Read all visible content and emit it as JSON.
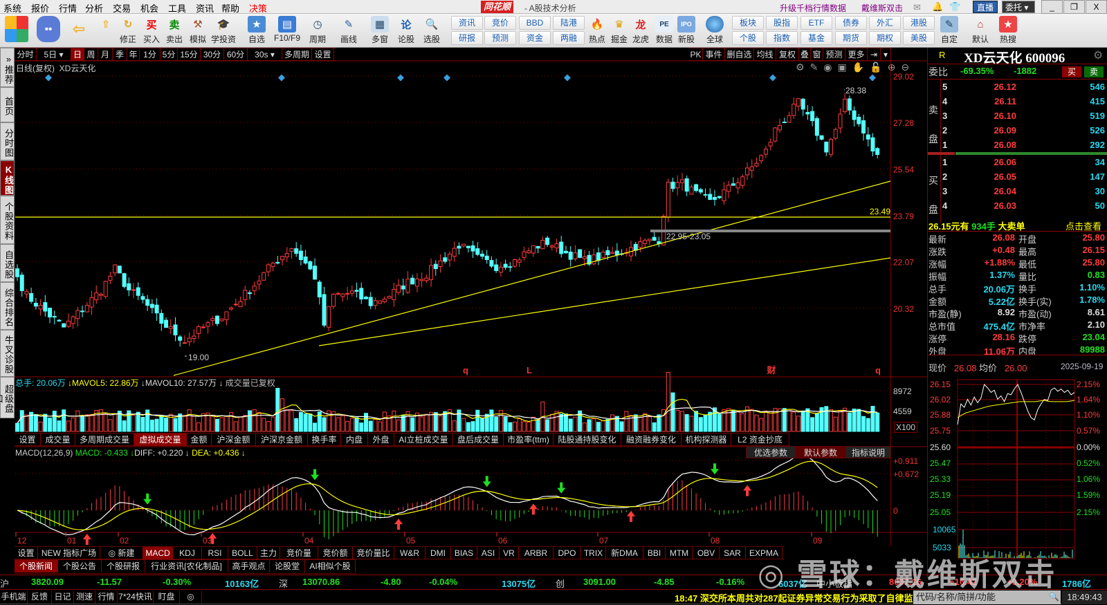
{
  "menu": [
    "系统",
    "报价",
    "行情",
    "分析",
    "交易",
    "机会",
    "工具",
    "资讯",
    "帮助",
    "决策"
  ],
  "title": {
    "logo": "同花顺",
    "app": "- A股技术分析",
    "promo1": "升级千档行情数据",
    "promo2": "戴维斯双击",
    "live": "直播",
    "entrust": "委托",
    "win_min": "_",
    "win_max": "❐",
    "win_close": "X"
  },
  "toolbar": {
    "icons": [
      {
        "label": "",
        "icon": "app-grid"
      },
      {
        "label": "",
        "icon": "robot"
      },
      {
        "label": "",
        "icon": "back-arrow"
      },
      {
        "label": "",
        "icon": "up-down-arrows"
      },
      {
        "label": "修正",
        "icon": "refresh"
      },
      {
        "label": "买入",
        "icon": "buy"
      },
      {
        "label": "卖出",
        "icon": "sell"
      },
      {
        "label": "模拟",
        "icon": "gavel"
      },
      {
        "label": "学投资",
        "icon": "graduation-cap"
      },
      {
        "label": "自选",
        "icon": "star-folder"
      },
      {
        "label": "F10/F9",
        "icon": "document"
      },
      {
        "label": "周期",
        "icon": "clock"
      },
      {
        "label": "画线",
        "icon": "pencil"
      },
      {
        "label": "多窗",
        "icon": "windows"
      },
      {
        "label": "论股",
        "icon": "forum"
      },
      {
        "label": "选股",
        "icon": "stock-search"
      }
    ],
    "pairs1": [
      [
        "资讯",
        "研报"
      ],
      [
        "竞价",
        "预测"
      ],
      [
        "BBD",
        "资金"
      ],
      [
        "陆港",
        "两融"
      ]
    ],
    "icons2": [
      {
        "label": "热点",
        "icon": "hot-fire"
      },
      {
        "label": "掘金",
        "icon": "gold"
      },
      {
        "label": "龙虎",
        "icon": "dragon"
      },
      {
        "label": "数据",
        "icon": "pe-data"
      },
      {
        "label": "新股",
        "icon": "ipo"
      },
      {
        "label": "全球",
        "icon": "globe"
      }
    ],
    "pairs2": [
      [
        "板块",
        "个股"
      ],
      [
        "股指",
        "指数"
      ],
      [
        "ETF",
        "基金"
      ],
      [
        "债券",
        "期货"
      ],
      [
        "外汇",
        "期权"
      ],
      [
        "港股",
        "美股"
      ]
    ],
    "icons3": [
      {
        "label": "自定",
        "icon": "customize"
      },
      {
        "label": "默认",
        "icon": "home"
      },
      {
        "label": "热搜",
        "icon": "hot-search"
      }
    ]
  },
  "sidebar": [
    {
      "label": "»推荐"
    },
    {
      "label": "首页"
    },
    {
      "label": "分时图"
    },
    {
      "label": "K线图",
      "active": true
    },
    {
      "label": "个股资料"
    },
    {
      "label": "自选股"
    },
    {
      "label": "综合排名"
    },
    {
      "label": "牛叉诊股"
    },
    {
      "label": "超级盘口"
    }
  ],
  "period_tabs": [
    {
      "label": "分时"
    },
    {
      "label": "5日 ▾"
    },
    {
      "label": "日",
      "active": true
    },
    {
      "label": "周"
    },
    {
      "label": "月"
    },
    {
      "label": "季"
    },
    {
      "label": "年"
    },
    {
      "label": "1分"
    },
    {
      "label": "5分"
    },
    {
      "label": "15分"
    },
    {
      "label": "30分"
    },
    {
      "label": "60分"
    },
    {
      "label": "30s ▾"
    },
    {
      "label": "多周期"
    },
    {
      "label": "设置"
    }
  ],
  "right_tabs": [
    "PK",
    "事件",
    "删自选",
    "均线",
    "复权",
    "叠",
    "窗",
    "预测",
    "更多",
    "⇥",
    "▾"
  ],
  "kchart": {
    "label": "日线(复权)",
    "stock": "XD云天化",
    "y_ticks": [
      29.02,
      27.28,
      25.54,
      23.79,
      22.07,
      20.32
    ],
    "high_label": "28.38",
    "low_label": "19.00",
    "hline_label": "23.49",
    "zone_label": "22.95-23.05",
    "events": [
      "q",
      "L",
      "财",
      "q"
    ],
    "dates": [
      "12",
      "01",
      "02",
      "03",
      "04",
      "05",
      "06",
      "07",
      "08",
      "09"
    ]
  },
  "chart_data": {
    "type": "candlestick",
    "title": "XD云天化 日线(复权)",
    "ylim": [
      19.0,
      29.02
    ],
    "close_keypoints": [
      [
        0,
        21.5
      ],
      [
        2,
        20.8
      ],
      [
        6,
        20.2
      ],
      [
        10,
        19.6
      ],
      [
        14,
        20.3
      ],
      [
        18,
        21.0
      ],
      [
        21,
        21.8
      ],
      [
        24,
        21.0
      ],
      [
        27,
        20.6
      ],
      [
        31,
        19.8
      ],
      [
        36,
        19.1
      ],
      [
        40,
        19.6
      ],
      [
        44,
        20.0
      ],
      [
        47,
        20.5
      ],
      [
        51,
        21.2
      ],
      [
        55,
        22.0
      ],
      [
        59,
        22.6
      ],
      [
        62,
        22.0
      ],
      [
        64,
        21.5
      ],
      [
        66,
        19.7
      ],
      [
        68,
        20.8
      ],
      [
        72,
        20.9
      ],
      [
        76,
        20.5
      ],
      [
        80,
        20.8
      ],
      [
        84,
        21.3
      ],
      [
        88,
        21.6
      ],
      [
        92,
        22.2
      ],
      [
        95,
        22.7
      ],
      [
        99,
        22.2
      ],
      [
        103,
        21.9
      ],
      [
        107,
        22.1
      ],
      [
        111,
        22.6
      ],
      [
        114,
        22.8
      ],
      [
        118,
        22.4
      ],
      [
        122,
        22.1
      ],
      [
        127,
        22.3
      ],
      [
        131,
        22.5
      ],
      [
        135,
        22.8
      ],
      [
        138,
        22.9
      ],
      [
        140,
        24.9
      ],
      [
        143,
        25.0
      ],
      [
        146,
        24.6
      ],
      [
        149,
        24.3
      ],
      [
        153,
        24.8
      ],
      [
        158,
        25.6
      ],
      [
        161,
        26.2
      ],
      [
        163,
        27.0
      ],
      [
        166,
        27.6
      ],
      [
        168,
        28.0
      ],
      [
        171,
        27.2
      ],
      [
        174,
        26.3
      ],
      [
        176,
        27.0
      ],
      [
        178,
        28.0
      ],
      [
        180,
        27.5
      ],
      [
        182,
        27.0
      ],
      [
        184,
        26.2
      ],
      [
        185,
        26.08
      ]
    ],
    "bars": 186,
    "volume_spikes": [
      [
        56,
        9500
      ],
      [
        57,
        7200
      ],
      [
        113,
        6500
      ],
      [
        140,
        13000
      ],
      [
        141,
        8500
      ],
      [
        150,
        5200
      ],
      [
        170,
        5000
      ]
    ],
    "volume_ticks": [
      8972,
      4559
    ],
    "macd_ticks": [
      "+0.911",
      "+0.672",
      "0"
    ]
  },
  "volume": {
    "total": "总手: 20.06万",
    "mavol5": "↓MAVOL5: 22.86万",
    "mavol10": "↓MAVOL10: 27.57万 ↓",
    "note": "成交量已复权",
    "unit": "X100",
    "tabs": [
      "设置",
      "成交量",
      "多周期成交量",
      "虚拟成交量",
      "金额",
      "沪深金额",
      "沪深京金额",
      "换手率",
      "内盘",
      "外盘",
      "AI立桩成交量",
      "盘后成交量",
      "市盈率(ttm)",
      "陆股通持股变化",
      "融资融券变化",
      "机构探测器",
      "L2 资金抄底"
    ]
  },
  "macd": {
    "name": "MACD(12,26,9)",
    "macd": "MACD: -0.433 ↓",
    "diff": "DIFF: +0.220 ↓",
    "dea": "DEA: +0.436 ↓",
    "buttons": [
      "优选参数",
      "默认参数",
      "指标说明"
    ]
  },
  "indicator_tabs": [
    "设置",
    "NEW 指标广场",
    "◎ 新建",
    "MACD",
    "KDJ",
    "RSI",
    "BOLL",
    "主力",
    "竞价量",
    "竞价额",
    "竞价量比",
    "W&R",
    "DMI",
    "BIAS",
    "ASI",
    "VR",
    "ARBR",
    "DPO",
    "TRIX",
    "新DMA",
    "BBI",
    "MTM",
    "OBV",
    "SAR",
    "EXPMA"
  ],
  "news_tabs": [
    "个股新闻",
    "个股公告",
    "个股研报",
    "行业资讯[农化制品]",
    "高手观点",
    "论股堂",
    "AI相似个股"
  ],
  "quote": {
    "r": "R",
    "title": "XD云天化 600096",
    "weibi_label": "委比",
    "weibi": "-69.35%",
    "weicha": "-1882",
    "buy": "买",
    "sell": "卖",
    "sell_label": "卖盘",
    "buy_label": "买盘",
    "asks": [
      {
        "n": "5",
        "p": "26.12",
        "v": "546"
      },
      {
        "n": "4",
        "p": "26.11",
        "v": "415"
      },
      {
        "n": "3",
        "p": "26.10",
        "v": "519"
      },
      {
        "n": "2",
        "p": "26.09",
        "v": "526"
      },
      {
        "n": "1",
        "p": "26.08",
        "v": "292"
      }
    ],
    "bids": [
      {
        "n": "1",
        "p": "26.06",
        "v": "34"
      },
      {
        "n": "2",
        "p": "26.05",
        "v": "147"
      },
      {
        "n": "3",
        "p": "26.04",
        "v": "30"
      },
      {
        "n": "4",
        "p": "26.03",
        "v": "50"
      }
    ],
    "big_order": {
      "price": "26.15元有",
      "qty": "934手",
      "text": "大卖单",
      "link": "点击查看"
    },
    "rows": [
      [
        "最新",
        "26.08",
        "rp",
        "开盘",
        "25.80",
        "rp"
      ],
      [
        "涨跌",
        "+0.48",
        "rp",
        "最高",
        "26.15",
        "rp"
      ],
      [
        "涨幅",
        "+1.88%",
        "rp",
        "最低",
        "25.80",
        "rp"
      ],
      [
        "振幅",
        "1.37%",
        "cy",
        "量比",
        "0.83",
        "gp"
      ],
      [
        "总手",
        "20.06万",
        "cy",
        "换手",
        "1.10%",
        "cy"
      ],
      [
        "金额",
        "5.22亿",
        "cy",
        "换手(实)",
        "1.78%",
        "cy"
      ],
      [
        "市盈(静)",
        "8.92",
        "wh",
        "市盈(动)",
        "8.61",
        "wh"
      ],
      [
        "总市值",
        "475.4亿",
        "cy",
        "市净率",
        "2.10",
        "wh"
      ],
      [
        "涨停",
        "28.16",
        "rp",
        "跌停",
        "23.04",
        "gp"
      ],
      [
        "外盘",
        "11.06万",
        "rp",
        "内盘",
        "89988",
        "gp"
      ]
    ],
    "now_label": "现价",
    "now": "26.08",
    "avg_label": "均价",
    "avg": "26.00",
    "date": "2025-09-19"
  },
  "intraday": {
    "left_ticks": [
      "26.15",
      "26.02",
      "25.88",
      "25.75",
      "25.60",
      "25.47",
      "25.33",
      "25.19",
      "25.05"
    ],
    "right_ticks": [
      "2.15%",
      "1.64%",
      "1.10%",
      "0.57%",
      "0.00%",
      "0.52%",
      "1.06%",
      "1.59%",
      "2.15%"
    ],
    "vol_ticks": [
      "10065",
      "5033"
    ],
    "prices": [
      25.8,
      25.98,
      25.95,
      26.02,
      25.97,
      26.04,
      25.99,
      26.03,
      26.15,
      26.12,
      26.08,
      26.1,
      26.02,
      26.05,
      26.0,
      26.07,
      26.06,
      26.11,
      26.15,
      26.08,
      26.0,
      25.92,
      25.86,
      25.84,
      25.93,
      25.98,
      26.02,
      26.01,
      26.1,
      26.12,
      26.09,
      26.11,
      26.08,
      26.1,
      26.06,
      26.08
    ],
    "avg": [
      25.86,
      25.9,
      25.92,
      25.94,
      25.96,
      25.97,
      25.98,
      25.99,
      26.0,
      26.0,
      26.0,
      26.01,
      26.0,
      26.0,
      26.0,
      26.01
    ]
  },
  "indices": [
    {
      "name": "沪",
      "value": "3820.09",
      "chg": "-11.57",
      "pct": "-0.30%",
      "amt": "10163亿",
      "color": "gp"
    },
    {
      "name": "深",
      "value": "13070.86",
      "chg": "-4.80",
      "pct": "-0.04%",
      "amt": "13075亿",
      "color": "gp"
    },
    {
      "name": "创",
      "value": "3091.00",
      "chg": "-4.85",
      "pct": "-0.16%",
      "amt": "6037亿",
      "color": "gp"
    },
    {
      "name": "中小板指",
      "value": "8037.16",
      "chg": "+16.42",
      "pct": "+0.20%",
      "amt": "1786亿",
      "color": "rp"
    }
  ],
  "statusbar": {
    "items": [
      "手机端",
      "反馈",
      "日记",
      "测速",
      "行情",
      "7*24快讯",
      "盯盘",
      "◎"
    ],
    "ticker": "18:47 深交所本周共对287起证券异常交易行为采取了自律监",
    "search_placeholder": "代码/名称/简拼/功能",
    "time": "18:49:43"
  },
  "watermark": "雪球：戴维斯双击",
  "colors": {
    "up": "#ff3c3c",
    "down": "#54ffff",
    "grid": "#8b0000",
    "ma_yellow": "#ffff00",
    "accent": "#8b0000"
  }
}
